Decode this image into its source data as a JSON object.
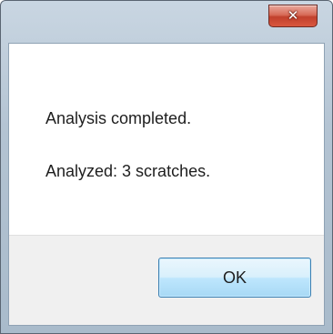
{
  "dialog": {
    "close_glyph": "✕",
    "messages": {
      "line1": "Analysis completed.",
      "line2": "Analyzed: 3 scratches."
    },
    "ok_label": "OK"
  },
  "colors": {
    "close_button": "#d05a45",
    "ok_border": "#3c7fb1",
    "footer_bg": "#f0f0f0"
  },
  "icons": {
    "close": "close-icon"
  }
}
